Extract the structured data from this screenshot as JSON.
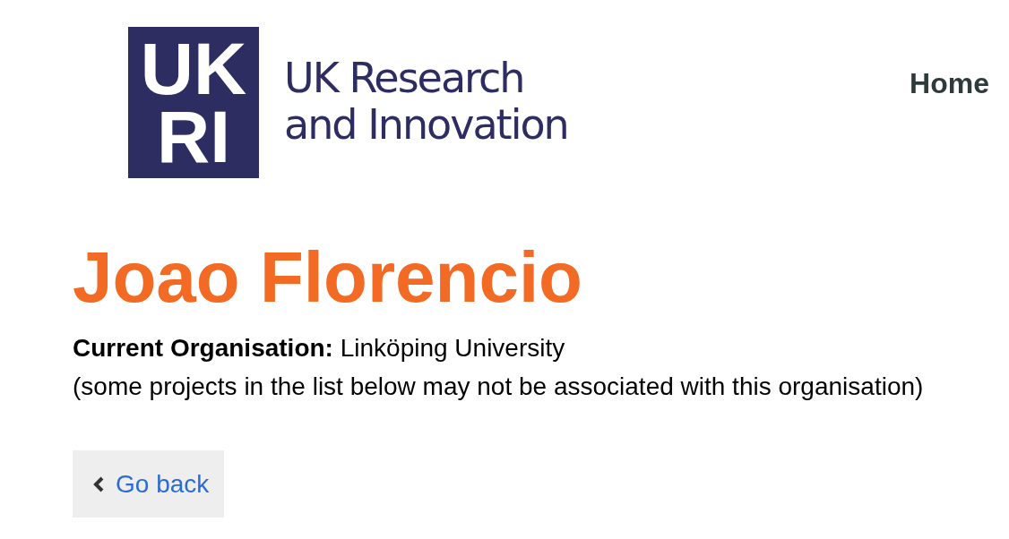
{
  "header": {
    "logo": {
      "mark_lines": [
        "UK",
        "RI"
      ],
      "wordmark_lines": [
        "UK Research",
        "and Innovation"
      ]
    },
    "nav": [
      {
        "label": "Home"
      }
    ]
  },
  "person": {
    "name": "Joao Florencio",
    "organisation": "**Current Organisation:** Linköping University",
    "note": "(some projects in the list below may not be associated with this organisation)"
  },
  "back_button": {
    "label": "Go back"
  }
}
